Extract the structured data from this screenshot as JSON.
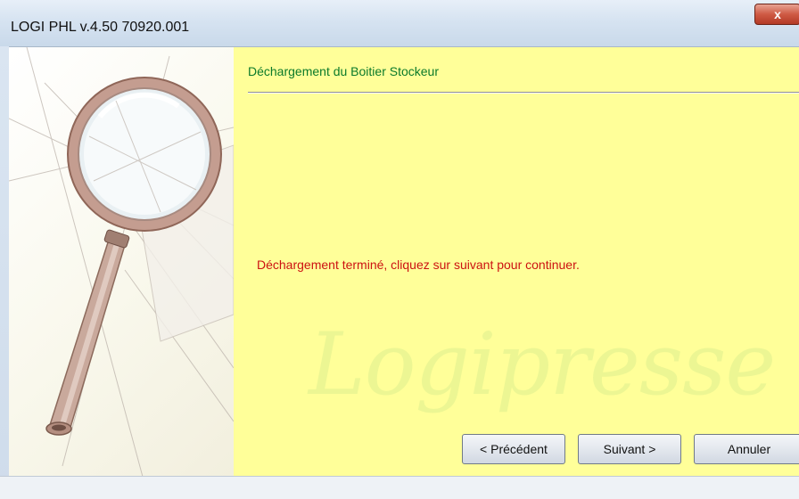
{
  "window": {
    "title": "LOGI PHL v.4.50 70920.001",
    "close_glyph": "x"
  },
  "wizard": {
    "heading": "Déchargement du Boitier Stockeur",
    "message": "Déchargement terminé, cliquez sur suivant pour continuer.",
    "watermark": "Logipresse",
    "illustration_icon": "magnifying-glass-icon"
  },
  "buttons": {
    "previous_label": "< Précédent",
    "next_label": "Suivant >",
    "cancel_label": "Annuler"
  },
  "colors": {
    "heading": "#0b7a2a",
    "message": "#cc1111",
    "panel_background": "#ffff99",
    "close_button": "#cf5a44"
  }
}
